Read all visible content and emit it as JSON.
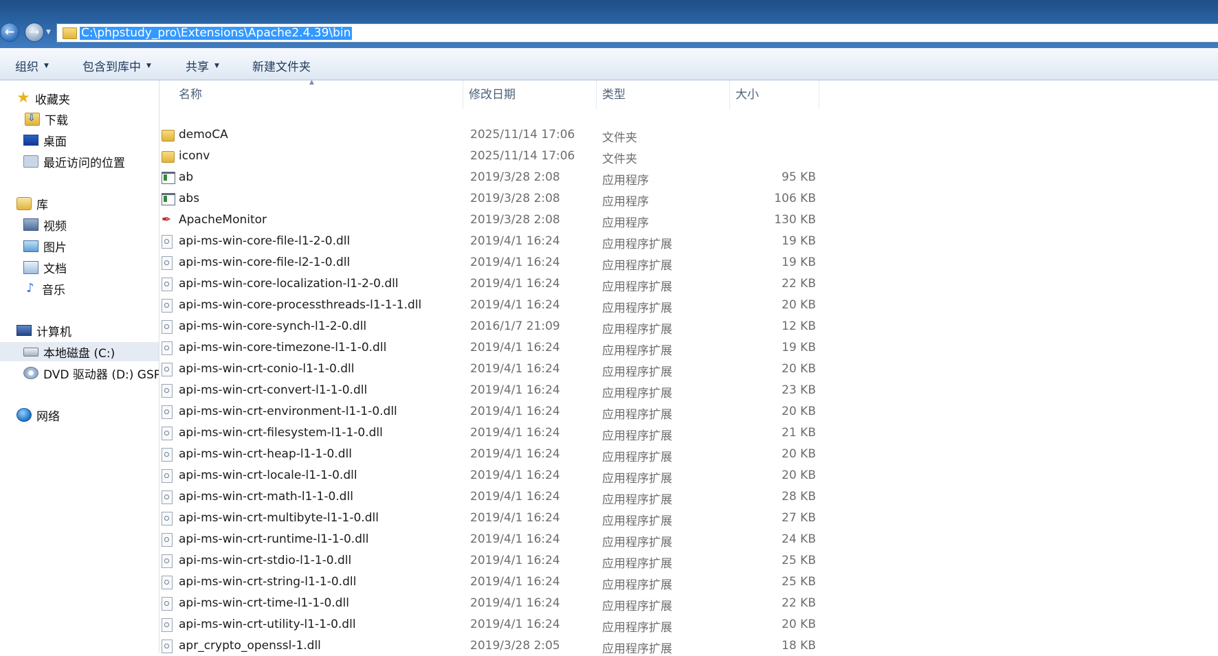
{
  "address_bar": {
    "path": "C:\\phpstudy_pro\\Extensions\\Apache2.4.39\\bin"
  },
  "toolbar": {
    "organize": "组织",
    "include_in_library": "包含到库中",
    "share": "共享",
    "new_folder": "新建文件夹"
  },
  "nav_pane": {
    "favorites": "收藏夹",
    "downloads": "下载",
    "desktop": "桌面",
    "recent_places": "最近访问的位置",
    "libraries": "库",
    "videos": "视频",
    "pictures": "图片",
    "documents": "文档",
    "music": "音乐",
    "computer": "计算机",
    "local_disk": "本地磁盘 (C:)",
    "dvd_drive": "DVD 驱动器 (D:) GSP",
    "network": "网络"
  },
  "columns": {
    "name": "名称",
    "date_modified": "修改日期",
    "type": "类型",
    "size": "大小"
  },
  "files": [
    {
      "name": "demoCA",
      "date": "2025/11/14 17:06",
      "type": "文件夹",
      "size": "",
      "icon": "folder-icon"
    },
    {
      "name": "iconv",
      "date": "2025/11/14 17:06",
      "type": "文件夹",
      "size": "",
      "icon": "folder-icon"
    },
    {
      "name": "ab",
      "date": "2019/3/28 2:08",
      "type": "应用程序",
      "size": "95 KB",
      "icon": "application-icon"
    },
    {
      "name": "abs",
      "date": "2019/3/28 2:08",
      "type": "应用程序",
      "size": "106 KB",
      "icon": "application-icon"
    },
    {
      "name": "ApacheMonitor",
      "date": "2019/3/28 2:08",
      "type": "应用程序",
      "size": "130 KB",
      "icon": "apache-feather-icon"
    },
    {
      "name": "api-ms-win-core-file-l1-2-0.dll",
      "date": "2019/4/1 16:24",
      "type": "应用程序扩展",
      "size": "19 KB",
      "icon": "dll-icon"
    },
    {
      "name": "api-ms-win-core-file-l2-1-0.dll",
      "date": "2019/4/1 16:24",
      "type": "应用程序扩展",
      "size": "19 KB",
      "icon": "dll-icon"
    },
    {
      "name": "api-ms-win-core-localization-l1-2-0.dll",
      "date": "2019/4/1 16:24",
      "type": "应用程序扩展",
      "size": "22 KB",
      "icon": "dll-icon"
    },
    {
      "name": "api-ms-win-core-processthreads-l1-1-1.dll",
      "date": "2019/4/1 16:24",
      "type": "应用程序扩展",
      "size": "20 KB",
      "icon": "dll-icon"
    },
    {
      "name": "api-ms-win-core-synch-l1-2-0.dll",
      "date": "2016/1/7 21:09",
      "type": "应用程序扩展",
      "size": "12 KB",
      "icon": "dll-icon"
    },
    {
      "name": "api-ms-win-core-timezone-l1-1-0.dll",
      "date": "2019/4/1 16:24",
      "type": "应用程序扩展",
      "size": "19 KB",
      "icon": "dll-icon"
    },
    {
      "name": "api-ms-win-crt-conio-l1-1-0.dll",
      "date": "2019/4/1 16:24",
      "type": "应用程序扩展",
      "size": "20 KB",
      "icon": "dll-icon"
    },
    {
      "name": "api-ms-win-crt-convert-l1-1-0.dll",
      "date": "2019/4/1 16:24",
      "type": "应用程序扩展",
      "size": "23 KB",
      "icon": "dll-icon"
    },
    {
      "name": "api-ms-win-crt-environment-l1-1-0.dll",
      "date": "2019/4/1 16:24",
      "type": "应用程序扩展",
      "size": "20 KB",
      "icon": "dll-icon"
    },
    {
      "name": "api-ms-win-crt-filesystem-l1-1-0.dll",
      "date": "2019/4/1 16:24",
      "type": "应用程序扩展",
      "size": "21 KB",
      "icon": "dll-icon"
    },
    {
      "name": "api-ms-win-crt-heap-l1-1-0.dll",
      "date": "2019/4/1 16:24",
      "type": "应用程序扩展",
      "size": "20 KB",
      "icon": "dll-icon"
    },
    {
      "name": "api-ms-win-crt-locale-l1-1-0.dll",
      "date": "2019/4/1 16:24",
      "type": "应用程序扩展",
      "size": "20 KB",
      "icon": "dll-icon"
    },
    {
      "name": "api-ms-win-crt-math-l1-1-0.dll",
      "date": "2019/4/1 16:24",
      "type": "应用程序扩展",
      "size": "28 KB",
      "icon": "dll-icon"
    },
    {
      "name": "api-ms-win-crt-multibyte-l1-1-0.dll",
      "date": "2019/4/1 16:24",
      "type": "应用程序扩展",
      "size": "27 KB",
      "icon": "dll-icon"
    },
    {
      "name": "api-ms-win-crt-runtime-l1-1-0.dll",
      "date": "2019/4/1 16:24",
      "type": "应用程序扩展",
      "size": "24 KB",
      "icon": "dll-icon"
    },
    {
      "name": "api-ms-win-crt-stdio-l1-1-0.dll",
      "date": "2019/4/1 16:24",
      "type": "应用程序扩展",
      "size": "25 KB",
      "icon": "dll-icon"
    },
    {
      "name": "api-ms-win-crt-string-l1-1-0.dll",
      "date": "2019/4/1 16:24",
      "type": "应用程序扩展",
      "size": "25 KB",
      "icon": "dll-icon"
    },
    {
      "name": "api-ms-win-crt-time-l1-1-0.dll",
      "date": "2019/4/1 16:24",
      "type": "应用程序扩展",
      "size": "22 KB",
      "icon": "dll-icon"
    },
    {
      "name": "api-ms-win-crt-utility-l1-1-0.dll",
      "date": "2019/4/1 16:24",
      "type": "应用程序扩展",
      "size": "20 KB",
      "icon": "dll-icon"
    },
    {
      "name": "apr_crypto_openssl-1.dll",
      "date": "2019/3/28 2:05",
      "type": "应用程序扩展",
      "size": "18 KB",
      "icon": "dll-icon"
    }
  ],
  "colors": {
    "title_bar": "#2a63a3",
    "address_selection": "#3399ff",
    "toolbar_text": "#1e395b",
    "nav_selected": "#e5ebf3"
  }
}
